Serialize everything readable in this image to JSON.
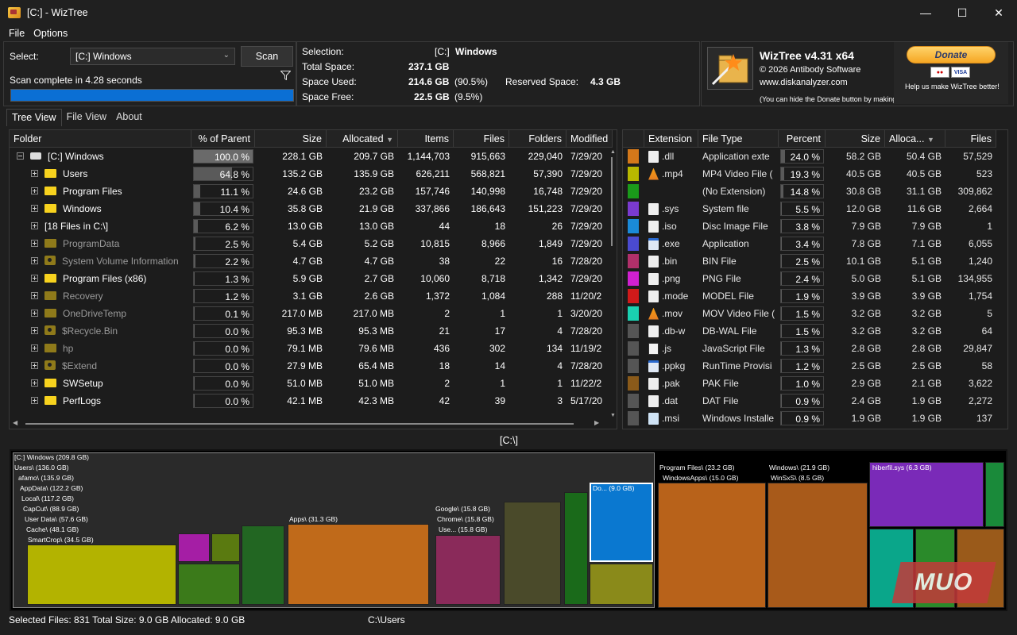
{
  "window": {
    "title": "[C:]  - WizTree"
  },
  "menu": [
    "File",
    "Options"
  ],
  "scan": {
    "select_label": "Select:",
    "drive": "[C:] Windows",
    "scan_button": "Scan",
    "status": "Scan complete in 4.28 seconds",
    "progress": 1.0
  },
  "info": {
    "selection_label": "Selection:",
    "selection_drive": "[C:]",
    "selection_name": "Windows",
    "total_label": "Total Space:",
    "total": "237.1 GB",
    "used_label": "Space Used:",
    "used": "214.6 GB",
    "used_pct": "(90.5%)",
    "reserved_label": "Reserved Space:",
    "reserved": "4.3 GB",
    "free_label": "Space Free:",
    "free": "22.5 GB",
    "free_pct": "(9.5%)"
  },
  "about": {
    "product": "WizTree v4.31 x64",
    "copyright": "© 2026 Antibody Software",
    "website": "www.diskanalyzer.com",
    "note": "(You can hide the Donate button by making a donation)",
    "donate": "Donate",
    "cards": [
      "MasterCard",
      "VISA"
    ],
    "help": "Help us make WizTree better!"
  },
  "tabs": [
    "Tree View",
    "File View",
    "About"
  ],
  "tree": {
    "columns": [
      "Folder",
      "% of Parent",
      "Size",
      "Allocated",
      "Items",
      "Files",
      "Folders",
      "Modified"
    ],
    "rows": [
      {
        "name": "[C:] Windows",
        "type": "drive",
        "pct": "100.0 %",
        "pct_value": 100.0,
        "size": "228.1 GB",
        "allocated": "209.7 GB",
        "items": "1,144,703",
        "files": "915,663",
        "folders": "229,040",
        "modified": "7/29/20"
      },
      {
        "name": "Users",
        "type": "folder",
        "pct": "64.8 %",
        "pct_value": 64.8,
        "size": "135.2 GB",
        "allocated": "135.9 GB",
        "items": "626,211",
        "files": "568,821",
        "folders": "57,390",
        "modified": "7/29/20"
      },
      {
        "name": "Program Files",
        "type": "folder",
        "pct": "11.1 %",
        "pct_value": 11.1,
        "size": "24.6 GB",
        "allocated": "23.2 GB",
        "items": "157,746",
        "files": "140,998",
        "folders": "16,748",
        "modified": "7/29/20"
      },
      {
        "name": "Windows",
        "type": "folder",
        "pct": "10.4 %",
        "pct_value": 10.4,
        "size": "35.8 GB",
        "allocated": "21.9 GB",
        "items": "337,866",
        "files": "186,643",
        "folders": "151,223",
        "modified": "7/29/20"
      },
      {
        "name": "[18 Files in C:\\]",
        "type": "files",
        "pct": "6.2 %",
        "pct_value": 6.2,
        "size": "13.0 GB",
        "allocated": "13.0 GB",
        "items": "44",
        "files": "18",
        "folders": "26",
        "modified": "7/29/20"
      },
      {
        "name": "ProgramData",
        "type": "hidden",
        "pct": "2.5 %",
        "pct_value": 2.5,
        "size": "5.4 GB",
        "allocated": "5.2 GB",
        "items": "10,815",
        "files": "8,966",
        "folders": "1,849",
        "modified": "7/29/20"
      },
      {
        "name": "System Volume Information",
        "type": "system",
        "pct": "2.2 %",
        "pct_value": 2.2,
        "size": "4.7 GB",
        "allocated": "4.7 GB",
        "items": "38",
        "files": "22",
        "folders": "16",
        "modified": "7/28/20"
      },
      {
        "name": "Program Files (x86)",
        "type": "folder",
        "pct": "1.3 %",
        "pct_value": 1.3,
        "size": "5.9 GB",
        "allocated": "2.7 GB",
        "items": "10,060",
        "files": "8,718",
        "folders": "1,342",
        "modified": "7/29/20"
      },
      {
        "name": "Recovery",
        "type": "hidden",
        "pct": "1.2 %",
        "pct_value": 1.2,
        "size": "3.1 GB",
        "allocated": "2.6 GB",
        "items": "1,372",
        "files": "1,084",
        "folders": "288",
        "modified": "11/20/2"
      },
      {
        "name": "OneDriveTemp",
        "type": "hidden",
        "pct": "0.1 %",
        "pct_value": 0.1,
        "size": "217.0 MB",
        "allocated": "217.0 MB",
        "items": "2",
        "files": "1",
        "folders": "1",
        "modified": "3/20/20"
      },
      {
        "name": "$Recycle.Bin",
        "type": "system",
        "pct": "0.0 %",
        "pct_value": 0.0,
        "size": "95.3 MB",
        "allocated": "95.3 MB",
        "items": "21",
        "files": "17",
        "folders": "4",
        "modified": "7/28/20"
      },
      {
        "name": "hp",
        "type": "hidden",
        "pct": "0.0 %",
        "pct_value": 0.0,
        "size": "79.1 MB",
        "allocated": "79.6 MB",
        "items": "436",
        "files": "302",
        "folders": "134",
        "modified": "11/19/2"
      },
      {
        "name": "$Extend",
        "type": "system",
        "pct": "0.0 %",
        "pct_value": 0.0,
        "size": "27.9 MB",
        "allocated": "65.4 MB",
        "items": "18",
        "files": "14",
        "folders": "4",
        "modified": "7/28/20"
      },
      {
        "name": "SWSetup",
        "type": "folder",
        "pct": "0.0 %",
        "pct_value": 0.0,
        "size": "51.0 MB",
        "allocated": "51.0 MB",
        "items": "2",
        "files": "1",
        "folders": "1",
        "modified": "11/22/2"
      },
      {
        "name": "PerfLogs",
        "type": "folder",
        "pct": "0.0 %",
        "pct_value": 0.0,
        "size": "42.1 MB",
        "allocated": "42.3 MB",
        "items": "42",
        "files": "39",
        "folders": "3",
        "modified": "5/17/20"
      }
    ]
  },
  "filetypes": {
    "columns": [
      "Extension",
      "File Type",
      "Percent",
      "Size",
      "Alloca...",
      "Files"
    ],
    "rows": [
      {
        "color": "#d4781a",
        "icon": "file-icon",
        "ext": ".dll",
        "type": "Application exte",
        "pct": "24.0 %",
        "pct_value": 24.0,
        "size": "58.2 GB",
        "allocated": "50.4 GB",
        "files": "57,529"
      },
      {
        "color": "#b8b800",
        "icon": "vlc-icon",
        "ext": ".mp4",
        "type": "MP4 Video File (",
        "pct": "19.3 %",
        "pct_value": 19.3,
        "size": "40.5 GB",
        "allocated": "40.5 GB",
        "files": "523"
      },
      {
        "color": "#1a9a1a",
        "icon": "",
        "ext": "",
        "type": "(No Extension)",
        "pct": "14.8 %",
        "pct_value": 14.8,
        "size": "30.8 GB",
        "allocated": "31.1 GB",
        "files": "309,862"
      },
      {
        "color": "#7a3ad0",
        "icon": "file-icon",
        "ext": ".sys",
        "type": "System file",
        "pct": "5.5 %",
        "pct_value": 5.5,
        "size": "12.0 GB",
        "allocated": "11.6 GB",
        "files": "2,664"
      },
      {
        "color": "#1a8ad8",
        "icon": "file-icon",
        "ext": ".iso",
        "type": "Disc Image File",
        "pct": "3.8 %",
        "pct_value": 3.8,
        "size": "7.9 GB",
        "allocated": "7.9 GB",
        "files": "1"
      },
      {
        "color": "#4a4ad0",
        "icon": "app-icon",
        "ext": ".exe",
        "type": "Application",
        "pct": "3.4 %",
        "pct_value": 3.4,
        "size": "7.8 GB",
        "allocated": "7.1 GB",
        "files": "6,055"
      },
      {
        "color": "#b0306a",
        "icon": "file-icon",
        "ext": ".bin",
        "type": "BIN File",
        "pct": "2.5 %",
        "pct_value": 2.5,
        "size": "10.1 GB",
        "allocated": "5.1 GB",
        "files": "1,240"
      },
      {
        "color": "#d020d0",
        "icon": "file-icon",
        "ext": ".png",
        "type": "PNG File",
        "pct": "2.4 %",
        "pct_value": 2.4,
        "size": "5.0 GB",
        "allocated": "5.1 GB",
        "files": "134,955"
      },
      {
        "color": "#d01a1a",
        "icon": "file-icon",
        "ext": ".mode",
        "type": "MODEL File",
        "pct": "1.9 %",
        "pct_value": 1.9,
        "size": "3.9 GB",
        "allocated": "3.9 GB",
        "files": "1,754"
      },
      {
        "color": "#1ad0b0",
        "icon": "vlc-icon",
        "ext": ".mov",
        "type": "MOV Video File (",
        "pct": "1.5 %",
        "pct_value": 1.5,
        "size": "3.2 GB",
        "allocated": "3.2 GB",
        "files": "5"
      },
      {
        "color": "#555555",
        "icon": "file-icon",
        "ext": ".db-w",
        "type": "DB-WAL File",
        "pct": "1.5 %",
        "pct_value": 1.5,
        "size": "3.2 GB",
        "allocated": "3.2 GB",
        "files": "64"
      },
      {
        "color": "#555555",
        "icon": "js-icon",
        "ext": ".js",
        "type": "JavaScript File",
        "pct": "1.3 %",
        "pct_value": 1.3,
        "size": "2.8 GB",
        "allocated": "2.8 GB",
        "files": "29,847"
      },
      {
        "color": "#555555",
        "icon": "app-icon",
        "ext": ".ppkg",
        "type": "RunTime Provisi",
        "pct": "1.2 %",
        "pct_value": 1.2,
        "size": "2.5 GB",
        "allocated": "2.5 GB",
        "files": "58"
      },
      {
        "color": "#8a5a1a",
        "icon": "file-icon",
        "ext": ".pak",
        "type": "PAK File",
        "pct": "1.0 %",
        "pct_value": 1.0,
        "size": "2.9 GB",
        "allocated": "2.1 GB",
        "files": "3,622"
      },
      {
        "color": "#555555",
        "icon": "file-icon",
        "ext": ".dat",
        "type": "DAT File",
        "pct": "0.9 %",
        "pct_value": 0.9,
        "size": "2.4 GB",
        "allocated": "1.9 GB",
        "files": "2,272"
      },
      {
        "color": "#555555",
        "icon": "msi-icon",
        "ext": ".msi",
        "type": "Windows Installe",
        "pct": "0.9 %",
        "pct_value": 0.9,
        "size": "1.9 GB",
        "allocated": "1.9 GB",
        "files": "137"
      }
    ]
  },
  "path_label": "[C:\\]",
  "treemap": {
    "labels": [
      "[C:] Windows  (209.8 GB)",
      "Users\\ (136.0 GB)",
      "afamo\\ (135.9 GB)",
      "AppData\\ (122.2 GB)",
      "Local\\ (117.2 GB)",
      "CapCut\\ (88.9 GB)",
      "User Data\\ (57.6 GB)",
      "Cache\\ (48.1 GB)",
      "SmartCrop\\ (34.5 GB)",
      "Apps\\ (31.3 GB)",
      "Google\\ (15.8 GB)",
      "Chrome\\ (15.8 GB)",
      "Use... (15.8 GB)",
      "Do... (9.0 GB)",
      "Program Files\\ (23.2 GB)",
      "WindowsApps\\ (15.0 GB)",
      "Windows\\ (21.9 GB)",
      "WinSxS\\ (8.5 GB)",
      "hiberfil.sys (6.3 GB)"
    ]
  },
  "statusbar": {
    "selected": "Selected Files: 831  Total Size: 9.0 GB  Allocated: 9.0 GB",
    "path": "C:\\Users"
  },
  "watermark": "MUO"
}
